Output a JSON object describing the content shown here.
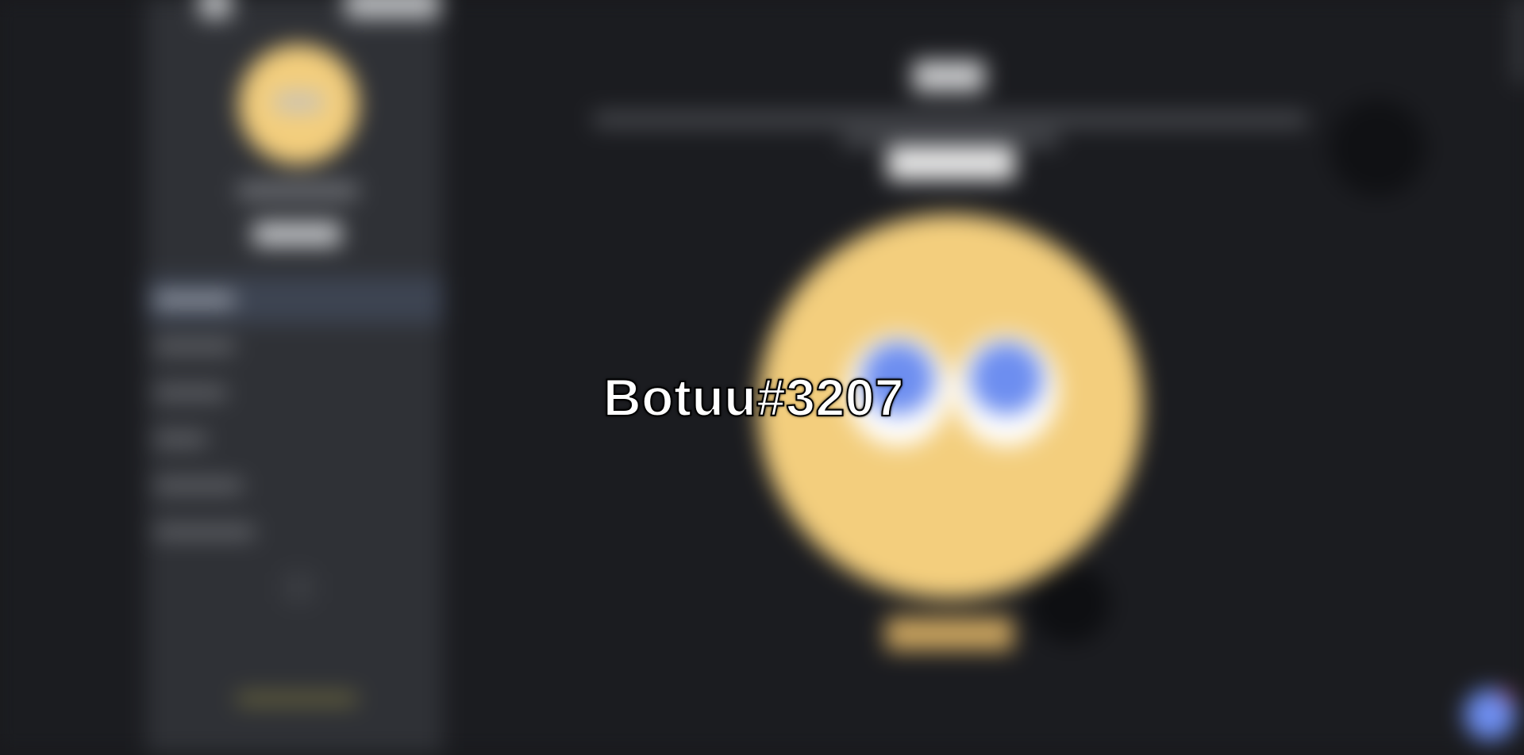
{
  "overlay": {
    "username": "Botuu#3207"
  },
  "colors": {
    "page_background": "#18191c",
    "sidebar_background": "#2f3136",
    "avatar_yellow": "#f3ce7d",
    "eye_blue": "#6d8ef0",
    "accent_gold": "#c9a35e",
    "active_nav": "#3d4452"
  },
  "icons": {
    "sidebar_add": "plus-icon",
    "corner": "assistant-icon"
  }
}
